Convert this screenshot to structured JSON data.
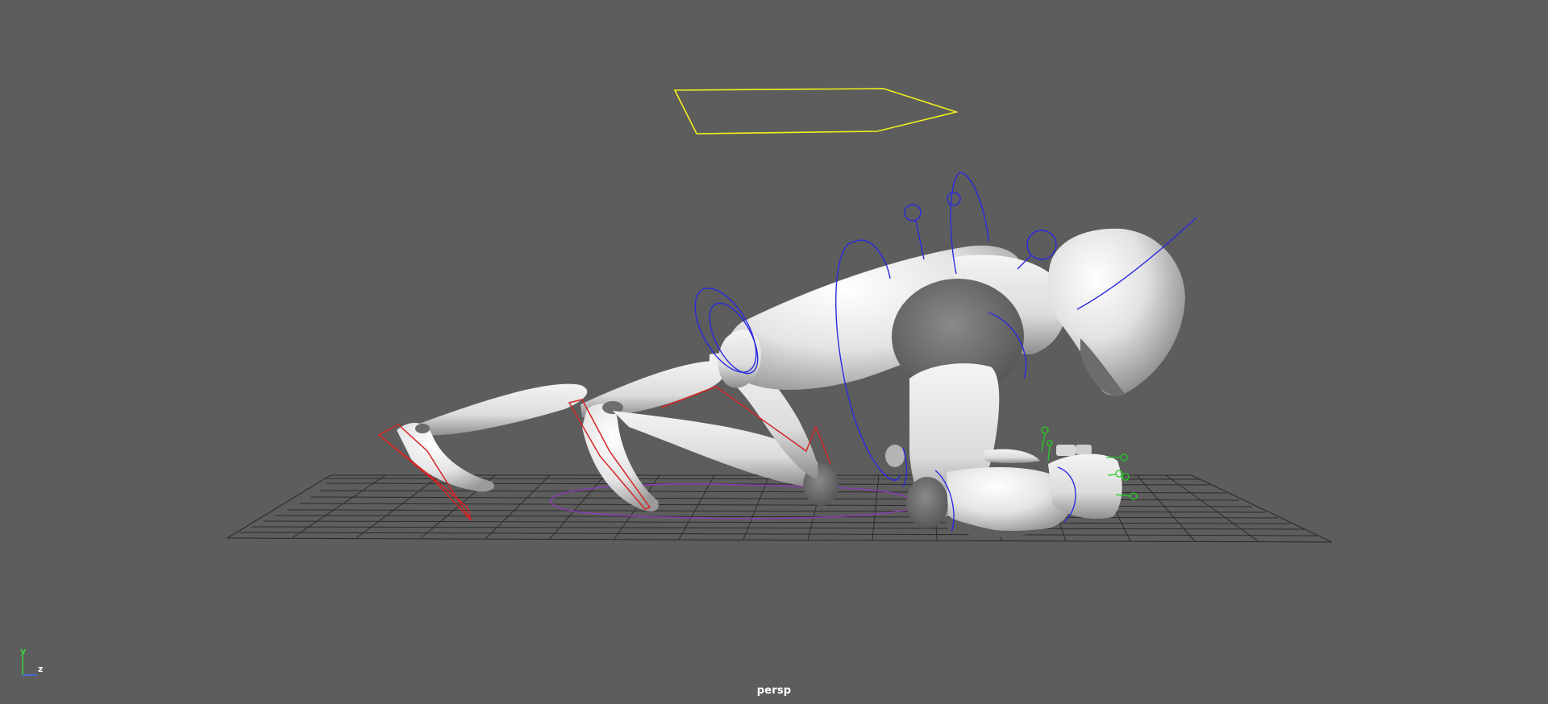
{
  "viewport": {
    "camera_name": "persp",
    "background_color": "#5d5d5d"
  },
  "axis_gizmo": {
    "y_label": "y",
    "z_label": "z",
    "y_color": "#39d339",
    "z_color": "#4a6bff"
  },
  "scene": {
    "grid_color": "#2b2b2b",
    "mesh_color": "#e4e4e4",
    "control_colors": {
      "root": "#f2f21a",
      "fk": "#2a2ae0",
      "ik_foot": "#d42424",
      "fingers": "#22cc22",
      "pivot": "#8c3bb8"
    }
  }
}
